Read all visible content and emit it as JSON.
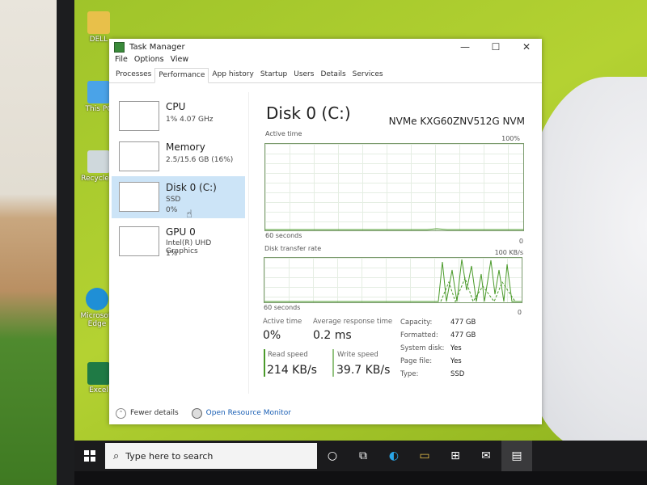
{
  "desktop": {
    "icons": [
      {
        "label": "DELL",
        "icon": "folder-icon"
      },
      {
        "label": "This PC",
        "icon": "computer-icon"
      },
      {
        "label": "Recycle B",
        "icon": "recycle-bin-icon"
      },
      {
        "label": "Microsoft Edge",
        "icon": "edge-icon"
      },
      {
        "label": "Excel",
        "icon": "excel-icon"
      }
    ]
  },
  "window": {
    "title": "Task Manager",
    "controls": {
      "minimize": "—",
      "maximize": "☐",
      "close": "✕"
    }
  },
  "menu": [
    "File",
    "Options",
    "View"
  ],
  "tabs": [
    "Processes",
    "Performance",
    "App history",
    "Startup",
    "Users",
    "Details",
    "Services"
  ],
  "active_tab": "Performance",
  "sidebar": [
    {
      "name": "CPU",
      "line1": "1% 4.07 GHz",
      "line2": ""
    },
    {
      "name": "Memory",
      "line1": "2.5/15.6 GB (16%)",
      "line2": ""
    },
    {
      "name": "Disk 0 (C:)",
      "line1": "SSD",
      "line2": "0%"
    },
    {
      "name": "GPU 0",
      "line1": "Intel(R) UHD Graphics",
      "line2": "1%"
    }
  ],
  "selected_item": "Disk 0 (C:)",
  "detail": {
    "title": "Disk 0 (C:)",
    "model": "NVMe KXG60ZNV512G NVM",
    "active_time_graph": {
      "label": "Active time",
      "max": "100%",
      "span": "60 seconds",
      "min": "0"
    },
    "transfer_graph": {
      "label": "Disk transfer rate",
      "max": "100 KB/s",
      "span": "60 seconds",
      "min": "0"
    },
    "stats": {
      "active_time_label": "Active time",
      "active_time": "0%",
      "avg_response_label": "Average response time",
      "avg_response": "0.2 ms",
      "read_speed_label": "Read speed",
      "read_speed": "214 KB/s",
      "write_speed_label": "Write speed",
      "write_speed": "39.7 KB/s"
    },
    "properties": [
      {
        "key": "Capacity:",
        "value": "477 GB"
      },
      {
        "key": "Formatted:",
        "value": "477 GB"
      },
      {
        "key": "System disk:",
        "value": "Yes"
      },
      {
        "key": "Page file:",
        "value": "Yes"
      },
      {
        "key": "Type:",
        "value": "SSD"
      }
    ]
  },
  "footer": {
    "fewer_details": "Fewer details",
    "open_resource_monitor": "Open Resource Monitor"
  },
  "taskbar": {
    "search_placeholder": "Type here to search",
    "icons": [
      "task-view-icon",
      "edge-icon",
      "file-explorer-icon",
      "store-icon",
      "mail-icon",
      "task-manager-icon"
    ]
  },
  "colors": {
    "selection": "#cce4f7",
    "graph_line": "#4a9a2a",
    "link": "#1a5fb4"
  }
}
